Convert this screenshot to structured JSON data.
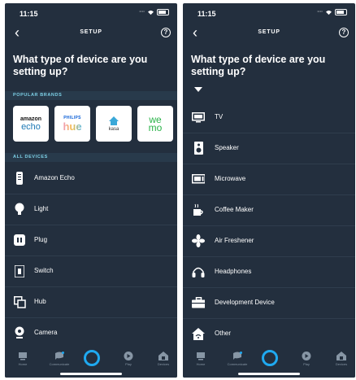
{
  "status": {
    "time": "11:15"
  },
  "nav": {
    "back": "‹",
    "title": "SETUP",
    "help": "?"
  },
  "heading": "What type of device are you setting up?",
  "sections": {
    "popular": "POPULAR BRANDS",
    "all": "ALL DEVICES"
  },
  "brands": [
    {
      "top": "amazon",
      "bottom": "echo"
    },
    {
      "top": "PHILIPS",
      "bottom": "hue"
    },
    {
      "bottom": "kasa"
    },
    {
      "top": "we",
      "bottom": "mo"
    }
  ],
  "left_devices": [
    "Amazon Echo",
    "Light",
    "Plug",
    "Switch",
    "Hub",
    "Camera"
  ],
  "right_devices": [
    "TV",
    "Speaker",
    "Microwave",
    "Coffee Maker",
    "Air Freshener",
    "Headphones",
    "Development Device",
    "Other"
  ],
  "tabs": {
    "home": "Home",
    "communicate": "Communicate",
    "play": "Play",
    "devices": "Devices"
  },
  "colors": {
    "background": "#232f3e",
    "accent": "#1fa9f0",
    "section": "#7dd0e6"
  }
}
